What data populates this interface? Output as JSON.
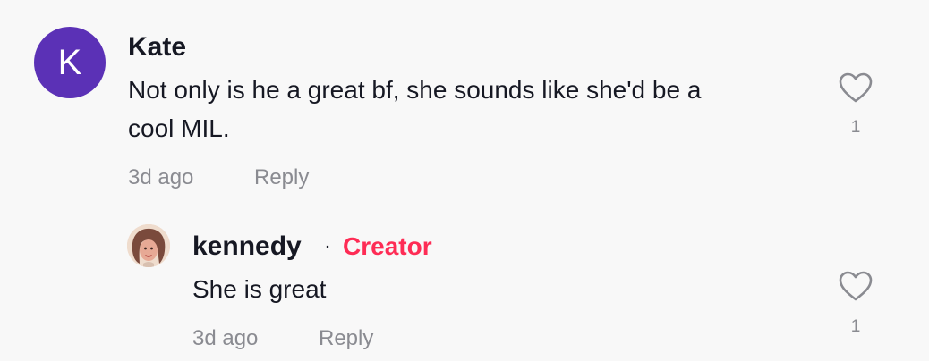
{
  "comments": [
    {
      "avatar_letter": "K",
      "avatar_color": "#5b31b6",
      "username": "Kate",
      "text_line1": "Not only is he a great bf, she sounds like she'd be a",
      "text_line2": "cool MIL.",
      "time": "3d ago",
      "reply_label": "Reply",
      "likes": "1"
    }
  ],
  "reply": {
    "username": "kennedy",
    "separator": "·",
    "badge": "Creator",
    "badge_color": "#fe2c55",
    "text": "She is great",
    "time": "3d ago",
    "reply_label": "Reply",
    "likes": "1"
  },
  "icons": {
    "like": "heart-outline-icon"
  }
}
